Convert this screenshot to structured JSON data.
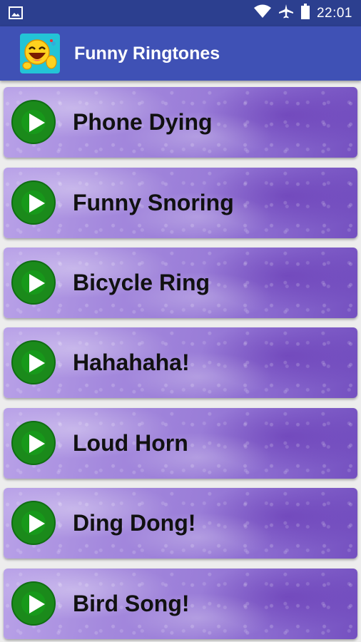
{
  "status_bar": {
    "time": "22:01",
    "icons": [
      "image-icon",
      "wifi-icon",
      "airplane-icon",
      "battery-icon"
    ]
  },
  "app_bar": {
    "title": "Funny Ringtones",
    "logo": "laughing-emoji-logo"
  },
  "ringtones": [
    {
      "label": "Phone Dying",
      "icon": "play-icon"
    },
    {
      "label": "Funny Snoring",
      "icon": "play-icon"
    },
    {
      "label": "Bicycle Ring",
      "icon": "play-icon"
    },
    {
      "label": "Hahahaha!",
      "icon": "play-icon"
    },
    {
      "label": "Loud Horn",
      "icon": "play-icon"
    },
    {
      "label": "Ding Dong!",
      "icon": "play-icon"
    },
    {
      "label": "Bird Song!",
      "icon": "play-icon"
    }
  ],
  "colors": {
    "status_bar": "#2c3f8f",
    "app_bar": "#3f51b5",
    "card_purple": "#9a7dd8",
    "play_green": "#1b8a1b"
  }
}
